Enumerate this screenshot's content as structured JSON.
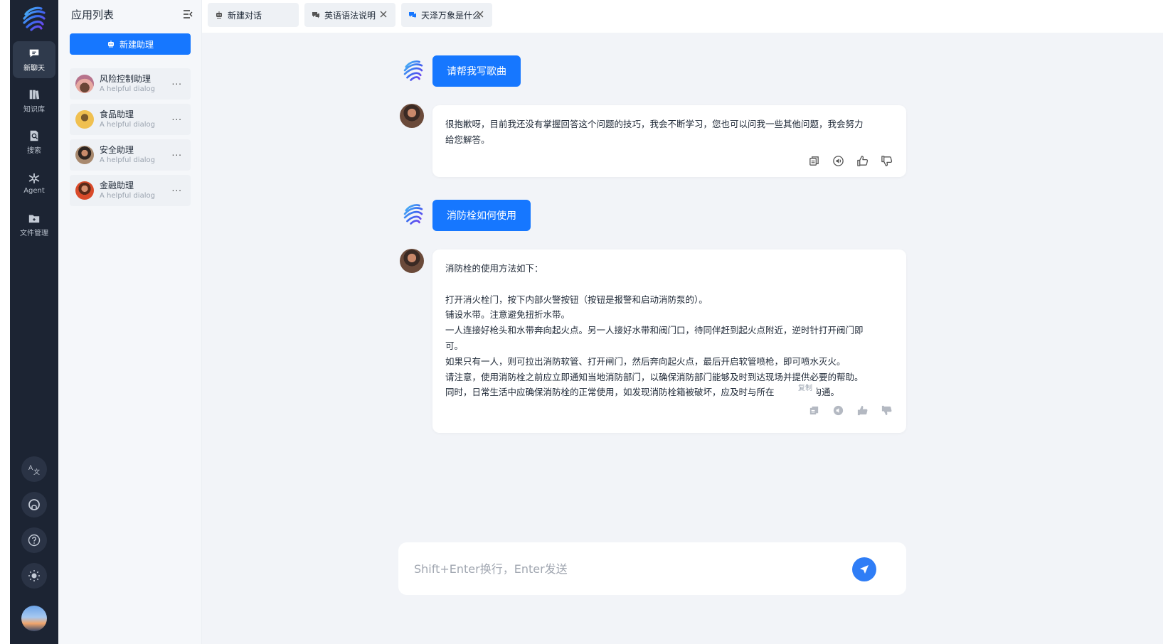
{
  "nav": {
    "items": [
      {
        "label": "新聊天",
        "icon": "chat-icon"
      },
      {
        "label": "知识库",
        "icon": "knowledge-icon"
      },
      {
        "label": "搜索",
        "icon": "search-doc-icon"
      },
      {
        "label": "Agent",
        "icon": "agent-icon"
      },
      {
        "label": "文件管理",
        "icon": "folder-icon"
      }
    ],
    "bottom_icons": [
      "translate-icon",
      "github-icon",
      "help-icon",
      "theme-sun-icon",
      "user-avatar"
    ]
  },
  "app_list": {
    "title": "应用列表",
    "new_assistant_label": "新建助理",
    "assistants": [
      {
        "name": "风险控制助理",
        "desc": "A helpful dialog",
        "more": "..."
      },
      {
        "name": "食品助理",
        "desc": "A helpful dialog",
        "more": "..."
      },
      {
        "name": "安全助理",
        "desc": "A helpful dialog",
        "more": "..."
      },
      {
        "name": "金融助理",
        "desc": "A helpful dialog",
        "more": "..."
      }
    ]
  },
  "tabs": [
    {
      "label": "新建对话",
      "closable": false
    },
    {
      "label": "英语语法说明",
      "closable": true
    },
    {
      "label": "天泽万象是什么",
      "closable": true,
      "active": true
    }
  ],
  "chat": {
    "messages": [
      {
        "role": "user",
        "text": "请帮我写歌曲"
      },
      {
        "role": "assistant",
        "lines": [
          "很抱歉呀，目前我还没有掌握回答这个问题的技巧，我会不断学习，您也可以问我一些其他问题，我会努力",
          "给您解答。"
        ]
      },
      {
        "role": "user",
        "text": "消防栓如何使用"
      },
      {
        "role": "assistant",
        "lines": [
          "消防栓的使用方法如下：",
          "",
          "打开消火栓门，按下内部火警按钮（按钮是报警和启动消防泵的）。",
          "铺设水带。注意避免扭折水带。",
          "一人连接好枪头和水带奔向起火点。另一人接好水带和阀门口，待同伴赶到起火点附近，逆时针打开阀门即",
          "可。",
          "如果只有一人，则可拉出消防软管、打开闸门，然后奔向起火点，最后开启软管喷枪，即可喷水灭火。",
          "请注意，使用消防栓之前应立即通知当地消防部门，以确保消防部门能够及时到达现场并提供必要的帮助。",
          "同时，日常生活中应确保消防栓的正常使用，如发现消防栓箱被破坏，应及时与所在",
          "沟通。"
        ]
      }
    ],
    "tooltip": "复制",
    "action_icons": [
      "copy-icon",
      "speak-icon",
      "thumbs-up-icon",
      "thumbs-down-icon"
    ]
  },
  "composer": {
    "placeholder": "Shift+Enter换行，Enter发送",
    "value": ""
  },
  "colors": {
    "accent": "#1677ff",
    "rail": "#1c2433",
    "main_bg": "#f2f4f8"
  }
}
